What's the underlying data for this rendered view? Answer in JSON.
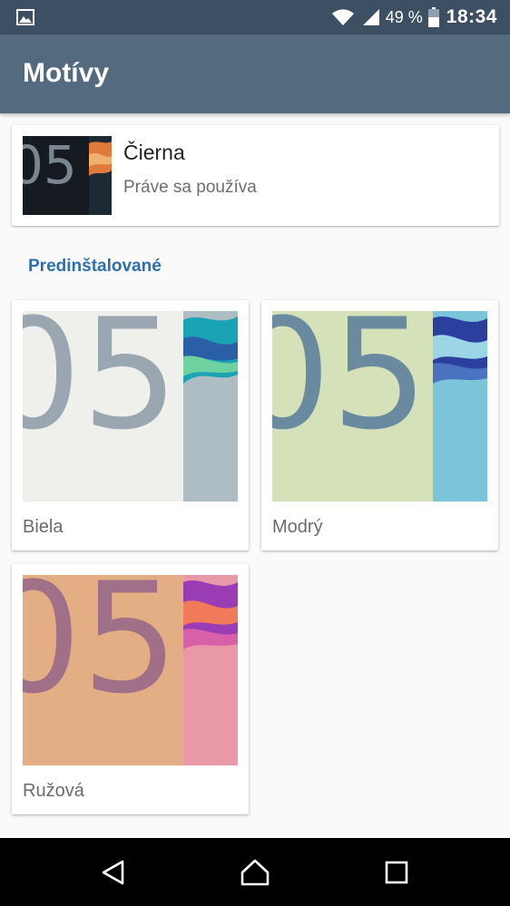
{
  "status_bar": {
    "battery_percent": "49 %",
    "time": "18:34",
    "icons": [
      "image-notification-icon",
      "wifi-icon",
      "cellular-signal-icon",
      "battery-icon"
    ]
  },
  "app_bar": {
    "title": "Motívy"
  },
  "current_theme": {
    "name": "Čierna",
    "status": "Práve sa používa",
    "thumb_text": "05"
  },
  "section": {
    "header": "Predinštalované"
  },
  "themes": [
    {
      "name": "Biela",
      "bg": "#efefec",
      "digit": "#8a9aa8",
      "accent1": "#1aa3b5",
      "accent2": "#2a5fa8"
    },
    {
      "name": "Modrý",
      "bg": "#d5e1b8",
      "digit": "#5d7f98",
      "accent1": "#3a58b0",
      "accent2": "#7ac3da"
    },
    {
      "name": "Ružová",
      "bg": "#e4ae84",
      "digit": "#9a6a80",
      "accent1": "#a53fb8",
      "accent2": "#e98ea0"
    }
  ],
  "nav_bar": {
    "icons": [
      "back-icon",
      "home-icon",
      "recent-apps-icon"
    ]
  },
  "colors": {
    "status_bar": "#3d4f62",
    "app_bar": "#546a7e",
    "section_header": "#2d6fb0",
    "background": "#fafafa"
  }
}
